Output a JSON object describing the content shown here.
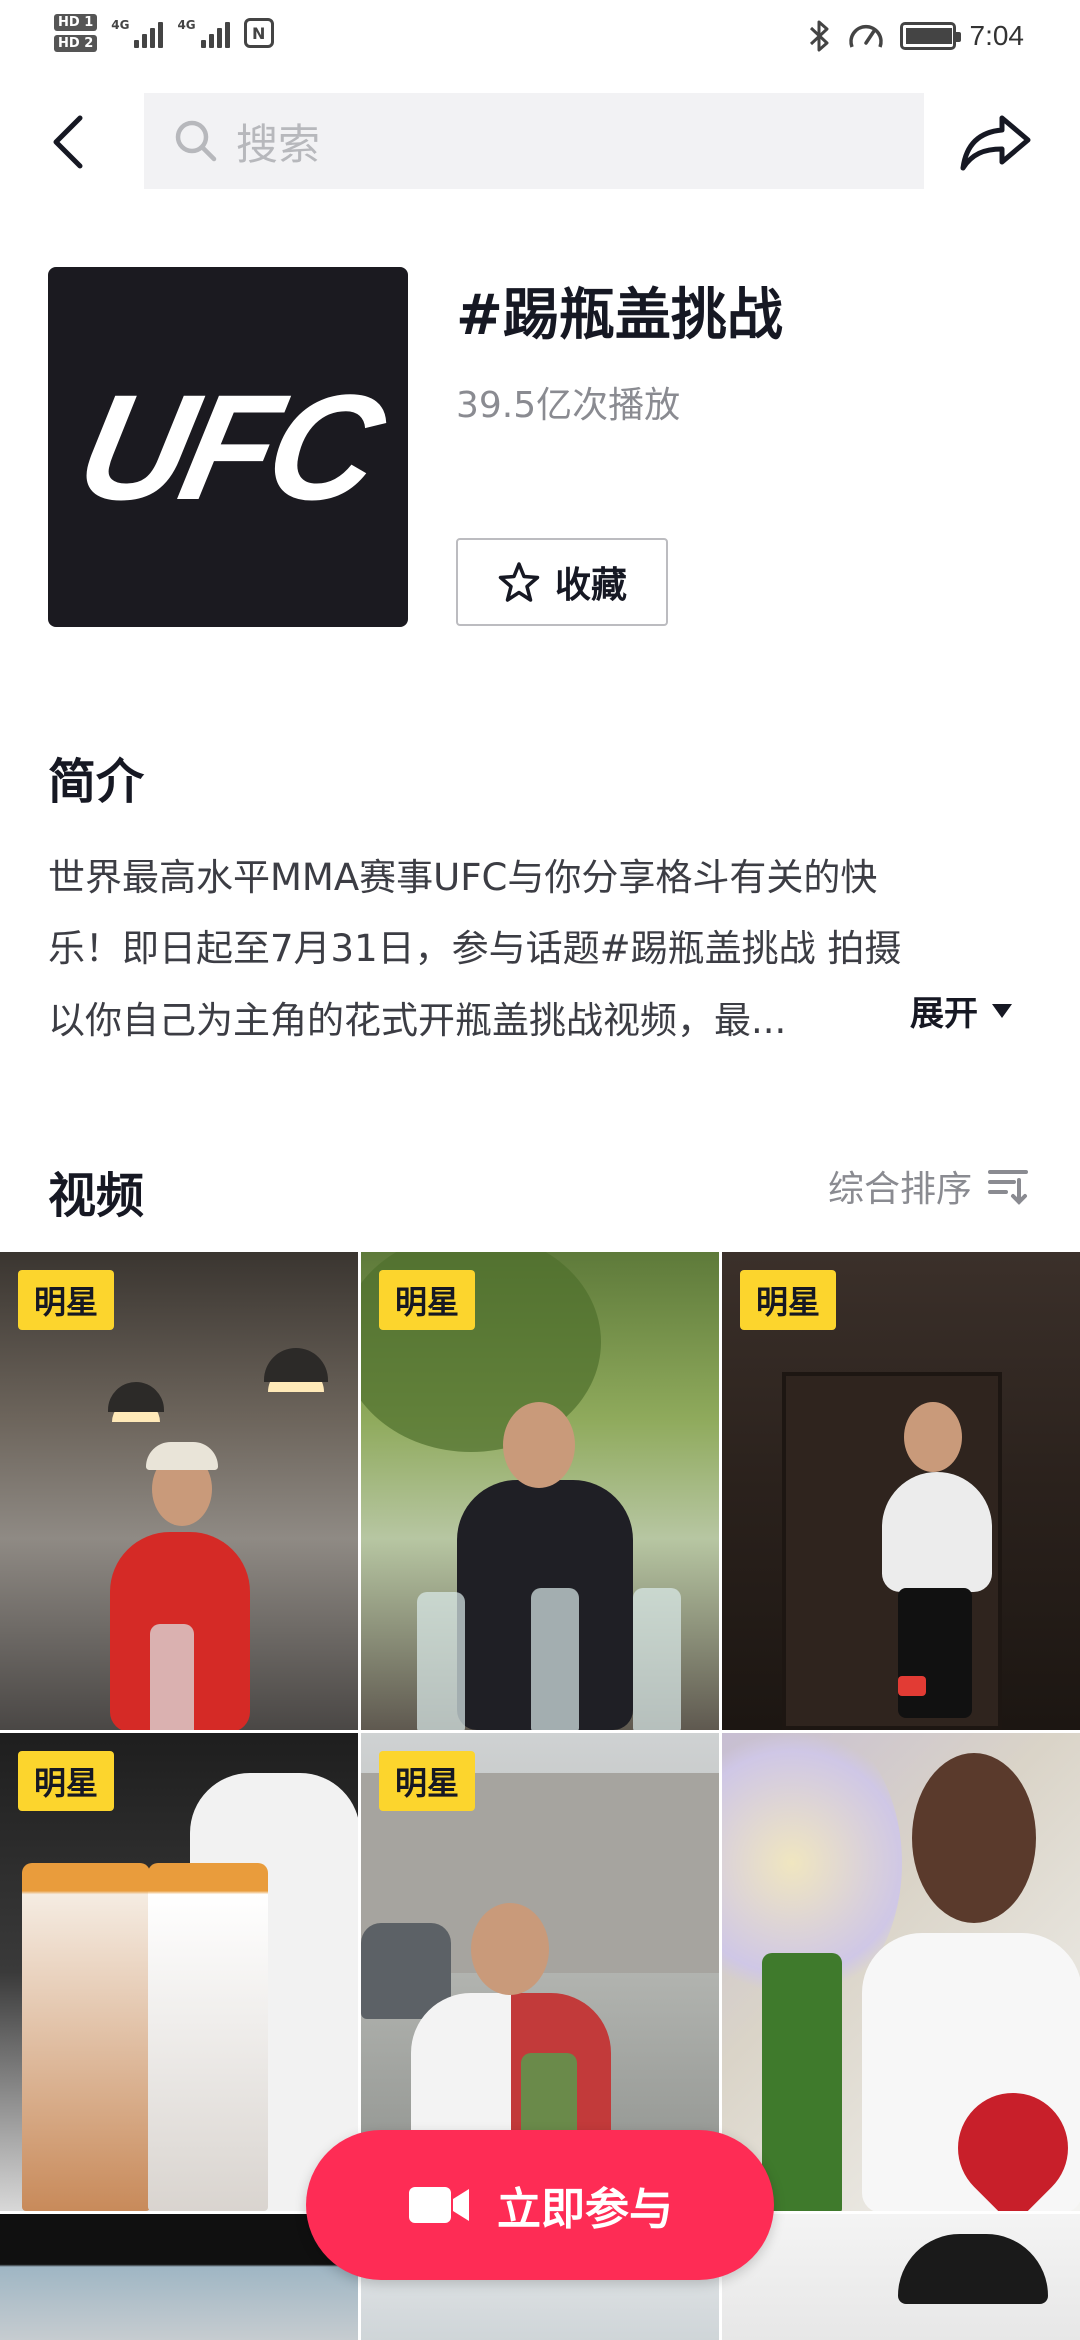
{
  "status_bar": {
    "hd1": "HD 1",
    "hd2": "HD 2",
    "net1": "4G",
    "net2": "4G",
    "nfc": "N",
    "time": "7:04",
    "icons": [
      "bluetooth-icon",
      "speed-icon",
      "battery-icon"
    ]
  },
  "header": {
    "back_icon": "chevron-left-icon",
    "search_placeholder": "搜索",
    "share_icon": "share-arrow-icon"
  },
  "topic": {
    "logo_text": "UFC",
    "title": "#踢瓶盖挑战",
    "plays": "39.5亿次播放",
    "favorite_label": "收藏",
    "favorite_icon": "star-outline-icon"
  },
  "intro": {
    "heading": "简介",
    "lines": [
      "世界最高水平MMA赛事UFC与你分享格斗有关的快",
      "乐！即日起至7月31日，参与话题#踢瓶盖挑战 拍摄",
      "以你自己为主角的花式开瓶盖挑战视频，最..."
    ],
    "expand_label": "展开"
  },
  "videos": {
    "heading": "视频",
    "sort_label": "综合排序",
    "sort_icon": "sort-filter-icon",
    "tiles": [
      {
        "badge": "明星"
      },
      {
        "badge": "明星"
      },
      {
        "badge": "明星"
      },
      {
        "badge": "明星"
      },
      {
        "badge": "明星"
      },
      {
        "badge": ""
      },
      {
        "badge": ""
      },
      {
        "badge": ""
      },
      {
        "badge": ""
      }
    ]
  },
  "join_button": {
    "label": "立即参与",
    "icon": "video-camera-icon"
  },
  "colors": {
    "accent": "#fe2c55",
    "badge": "#fcd52d",
    "text_primary": "#161823",
    "text_secondary": "#8a8b91"
  }
}
